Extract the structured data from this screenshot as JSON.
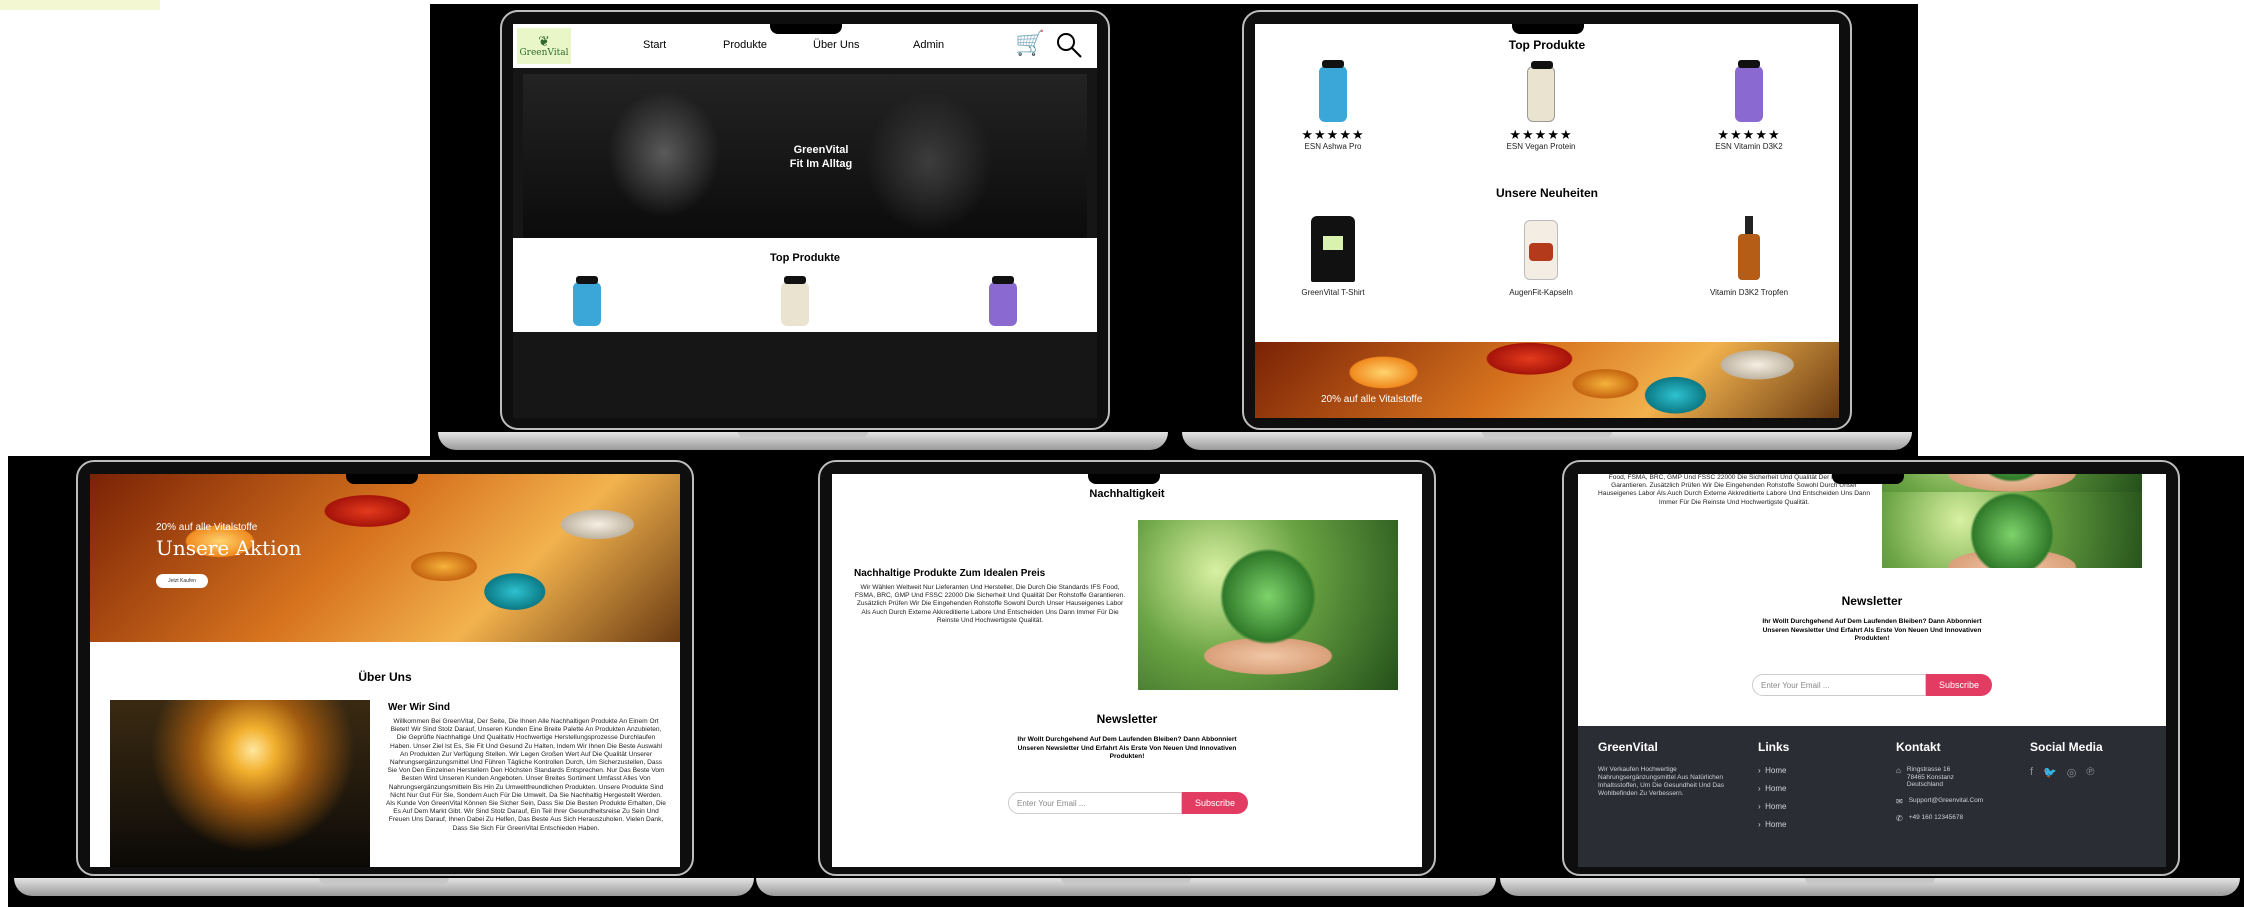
{
  "nav": {
    "logo": "GreenVital",
    "items": [
      "Start",
      "Produkte",
      "Über Uns",
      "Admin"
    ]
  },
  "hero": {
    "line1": "GreenVital",
    "line2": "Fit Im Alltag"
  },
  "top_products": {
    "title": "Top Produkte",
    "items": [
      {
        "name": "ESN Ashwa Pro",
        "stars": "★★★★★",
        "color": "#3aa7d8"
      },
      {
        "name": "ESN Vegan Protein",
        "stars": "★★★★★",
        "color": "#e9e3cf"
      },
      {
        "name": "ESN Vitamin D3K2",
        "stars": "★★★★★",
        "color": "#8a6ad1"
      }
    ]
  },
  "new_products": {
    "title": "Unsere Neuheiten",
    "items": [
      {
        "name": "GreenVital T-Shirt"
      },
      {
        "name": "AugenFit-Kapseln"
      },
      {
        "name": "Vitamin D3K2 Tropfen"
      }
    ]
  },
  "promo": {
    "small": "20% auf alle Vitalstoffe",
    "big": "Unsere Aktion",
    "button": "Jetzt Kaufen"
  },
  "about": {
    "title": "Über Uns",
    "subtitle": "Wer Wir Sind",
    "text": "Willkommen Bei GreenVital, Der Seite, Die Ihnen Alle Nachhaltigen Produkte An Einem Ort Bietet! Wir Sind Stolz Darauf, Unseren Kunden Eine Breite Palette An Produkten Anzubieten, Die Geprüfte Nachhaltige Und Qualitativ Hochwertige Herstellungsprozesse Durchlaufen Haben. Unser Ziel Ist Es, Sie Fit Und Gesund Zu Halten, Indem Wir Ihnen Die Beste Auswahl An Produkten Zur Verfügung Stellen. Wir Legen Großen Wert Auf Die Qualität Unserer Nahrungsergänzungsmittel Und Führen Tägliche Kontrollen Durch, Um Sicherzustellen, Dass Sie Von Den Einzelnen Herstellern Den Höchsten Standards Entsprechen. Nur Das Beste Vom Besten Wird Unseren Kunden Angeboten. Unser Breites Sortiment Umfasst Alles Von Nahrungsergänzungsmitteln Bis Hin Zu Umweltfreundlichen Produkten. Unsere Produkte Sind Nicht Nur Gut Für Sie, Sondern Auch Für Die Umwelt. Da Sie Nachhaltig Hergestellt Werden. Als Kunde Von GreenVital Können Sie Sicher Sein, Dass Sie Die Besten Produkte Erhalten, Die Es Auf Dem Markt Gibt. Wir Sind Stolz Darauf, Ein Teil Ihrer Gesundheitsreise Zu Sein Und Freuen Uns Darauf, Ihnen Dabei Zu Helfen, Das Beste Aus Sich Herauszuholen. Vielen Dank, Dass Sie Sich Für GreenVital Entschieden Haben."
  },
  "sustain": {
    "title": "Nachhaltigkeit",
    "subtitle": "Nachhaltige Produkte Zum Idealen Preis",
    "text": "Wir Wählen Weltweit Nur Lieferanten Und Hersteller, Die Durch Die Standards IFS Food, FSMA, BRC, GMP Und FSSC 22000 Die Sicherheit Und Qualität Der Rohstoffe Garantieren. Zusätzlich Prüfen Wir Die Eingehenden Rohstoffe Sowohl Durch Unser Hauseigenes Labor Als Auch Durch Externe Akkreditierte Labore Und Entscheiden Uns Dann Immer Für Die Reinste Und Hochwertigste Qualität.",
    "text_tail": "Food, FSMA, BRC, GMP Und FSSC 22000 Die Sicherheit Und Qualität Der Rohstoffe Garantieren. Zusätzlich Prüfen Wir Die Eingehenden Rohstoffe Sowohl Durch Unser Hauseigenes Labor Als Auch Durch Externe Akkreditierte Labore Und Entscheiden Uns Dann Immer Für Die Reinste Und Hochwertigste Qualität."
  },
  "newsletter": {
    "title": "Newsletter",
    "text": "Ihr Wollt Durchgehend Auf Dem Laufenden Bleiben? Dann Abbonniert Unseren Newsletter Und Erfahrt Als Erste Von Neuen Und Innovativen Produkten!",
    "placeholder": "Enter Your Email ...",
    "button": "Subscribe"
  },
  "footer": {
    "brand": "GreenVital",
    "brand_text": "Wir Verkaufen Hochwertige Nahrungsergänzungsmittel Aus Natürlichen Inhaltsstoffen, Um Die Gesundheit Und Das Wohlbefinden Zu Verbessern.",
    "links_title": "Links",
    "links": [
      "Home",
      "Home",
      "Home",
      "Home"
    ],
    "contact_title": "Kontakt",
    "address": "Ringstrasse 16\n78465 Konstanz\nDeutschland",
    "email": "Support@Greenvital.Com",
    "phone": "+49 160 12345678",
    "social_title": "Social Media"
  }
}
